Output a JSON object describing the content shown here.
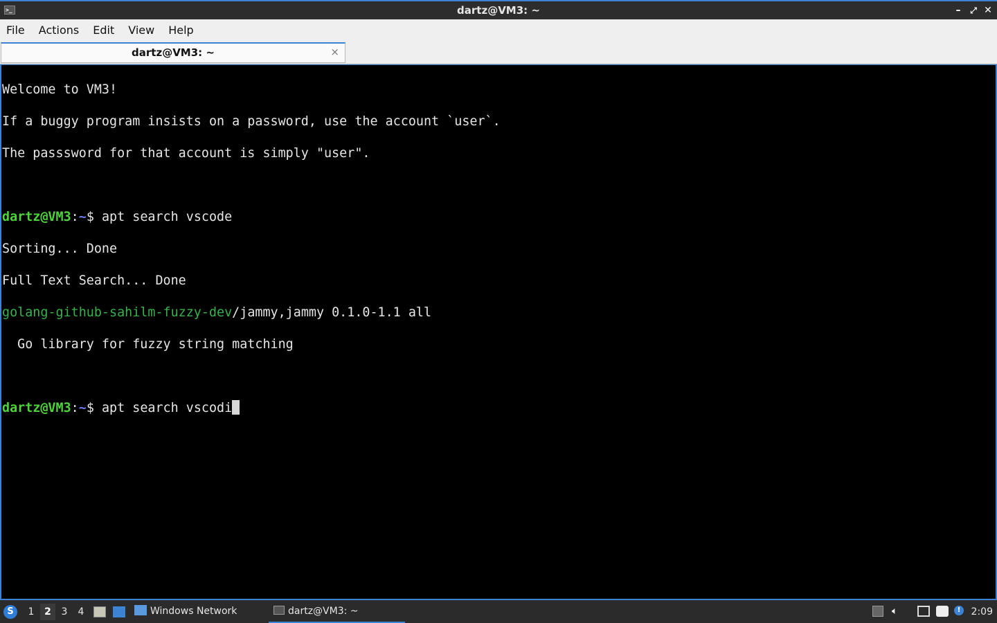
{
  "window": {
    "title": "dartz@VM3: ~",
    "controls": {
      "minimize": "–",
      "maximize": "⤢",
      "close": "✕"
    }
  },
  "menu": [
    "File",
    "Actions",
    "Edit",
    "View",
    "Help"
  ],
  "tab": {
    "label": "dartz@VM3: ~",
    "close": "×"
  },
  "terminal": {
    "motd": [
      "Welcome to VM3!",
      "If a buggy program insists on a password, use the account `user`.",
      "The passsword for that account is simply \"user\"."
    ],
    "prompt_user": "dartz@VM3",
    "prompt_sep": ":",
    "prompt_path": "~",
    "prompt_symbol": "$ ",
    "command1": "apt search vscode",
    "output": [
      "Sorting... Done",
      "Full Text Search... Done"
    ],
    "result_pkg": "golang-github-sahilm-fuzzy-dev",
    "result_rest": "/jammy,jammy 0.1.0-1.1 all",
    "result_desc": "  Go library for fuzzy string matching",
    "command2": "apt search vscodi"
  },
  "taskbar": {
    "workspaces": [
      "1",
      "2",
      "3",
      "4"
    ],
    "active_workspace": "2",
    "tasks": [
      {
        "label": "Windows Network"
      },
      {
        "label": "dartz@VM3: ~"
      }
    ],
    "clock": "2:09"
  },
  "colors": {
    "accent": "#3d83d4",
    "prompt_user": "#4fd33c",
    "prompt_path": "#6f7cf0",
    "package": "#37b24d"
  }
}
